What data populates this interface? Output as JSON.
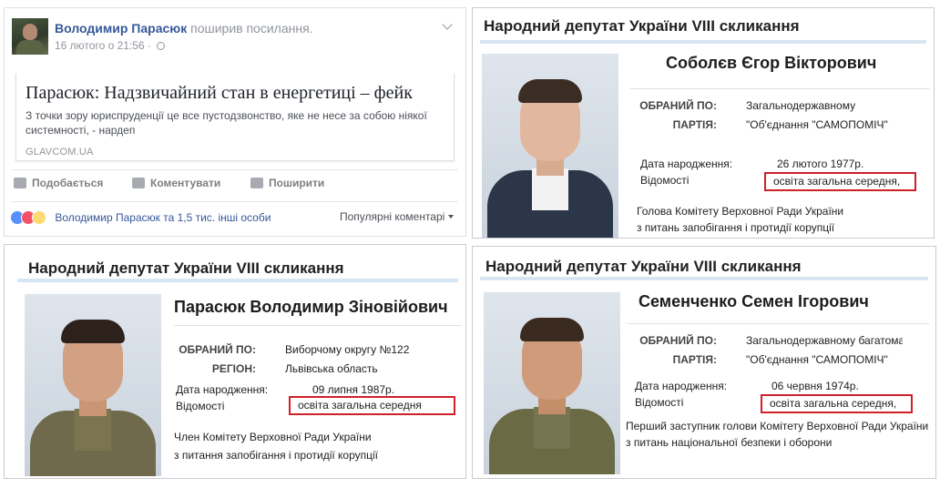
{
  "fb_post": {
    "author": "Володимир Парасюк",
    "action": "поширив посилання.",
    "timestamp": "16 лютого о 21:56 ·",
    "link": {
      "title": "Парасюк: Надзвичайний стан в енергетиці – фейк",
      "description": "З точки зору юриспруденції це все пустодзвонство, яке не несе за собою ніякої системності, - нардеп",
      "source": "GLAVCOM.UA"
    },
    "actions": {
      "like": "Подобається",
      "comment": "Коментувати",
      "share": "Поширити"
    },
    "reactions_text": "Володимир Парасюк та 1,5 тис. інші особи",
    "comments_filter": "Популярні коментарі"
  },
  "cards": {
    "sobolev": {
      "header": "Народний депутат України VIII скликання",
      "name": "Соболєв Єгор Вікторович",
      "elected_label": "ОБРАНИЙ ПО:",
      "elected_value": "Загальнодержавному",
      "party_label": "ПАРТІЯ:",
      "party_value": "\"Об'єднання \"САМОПОМІЧ\"",
      "birth_label": "Дата народження:",
      "birth_value": "26 лютого 1977р.",
      "info_label": "Відомості",
      "education": "освіта загальна середня,",
      "position_1": "Голова Комітету Верховної Ради України",
      "position_2": "з питань запобігання і протидії корупції"
    },
    "parasiuk": {
      "header": "Народний депутат України VIII скликання",
      "name": "Парасюк Володимир Зіновійович",
      "elected_label": "ОБРАНИЙ ПО:",
      "elected_value": "Виборчому округу №122",
      "region_label": "РЕГІОН:",
      "region_value": "Львівська область",
      "birth_label": "Дата народження:",
      "birth_value": "09 липня 1987р.",
      "info_label": "Відомості",
      "education": "освіта загальна середня",
      "position_1": "Член Комітету Верховної Ради України",
      "position_2": "з питання запобігання і протидії корупції"
    },
    "semenchenko": {
      "header": "Народний депутат України VIII скликання",
      "name": "Семенченко Семен Ігорович",
      "elected_label": "ОБРАНИЙ ПО:",
      "elected_value": "Загальнодержавному багатома",
      "party_label": "ПАРТІЯ:",
      "party_value": "\"Об'єднання \"САМОПОМІЧ\"",
      "birth_label": "Дата народження:",
      "birth_value": "06 червня 1974р.",
      "info_label": "Відомості",
      "education": "освіта загальна середня,",
      "position_1": "Перший заступник голови Комітету Верховної Ради України",
      "position_2": "з питань національної безпеки і оборони"
    }
  },
  "colors": {
    "fb_link_blue": "#365899",
    "highlight_red": "#d0202a",
    "header_rule": "#d6e6f4"
  }
}
